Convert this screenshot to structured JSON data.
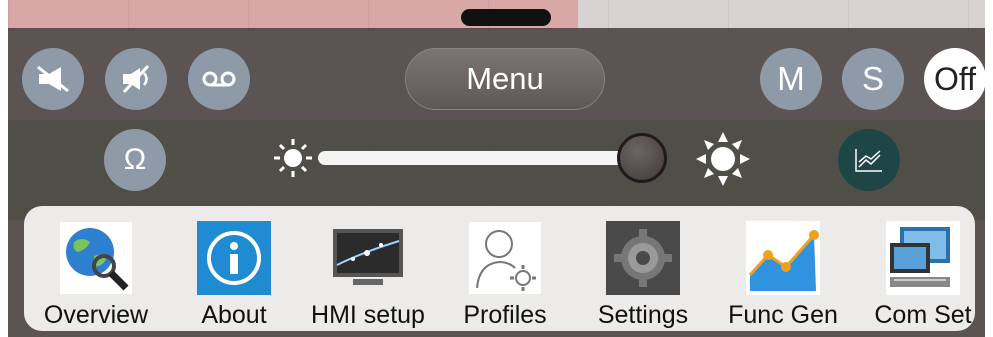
{
  "menu": {
    "label": "Menu"
  },
  "mode_buttons": {
    "m_label": "M",
    "s_label": "S",
    "off_label": "Off"
  },
  "ohm_button": {
    "label": "Ω"
  },
  "brightness": {
    "level": 0.94
  },
  "apps": [
    {
      "label": "Overview",
      "icon": "globe-magnifier-icon"
    },
    {
      "label": "About",
      "icon": "info-icon"
    },
    {
      "label": "HMI setup",
      "icon": "display-icon"
    },
    {
      "label": "Profiles",
      "icon": "user-gear-icon"
    },
    {
      "label": "Settings",
      "icon": "gears-icon"
    },
    {
      "label": "Func Gen",
      "icon": "line-chart-icon"
    },
    {
      "label": "Com Set",
      "icon": "network-computer-icon"
    }
  ],
  "colors": {
    "accent_blue": "#1e8bd3",
    "chart_btn": "#1f4646",
    "round_btn": "#8e9aa8"
  }
}
